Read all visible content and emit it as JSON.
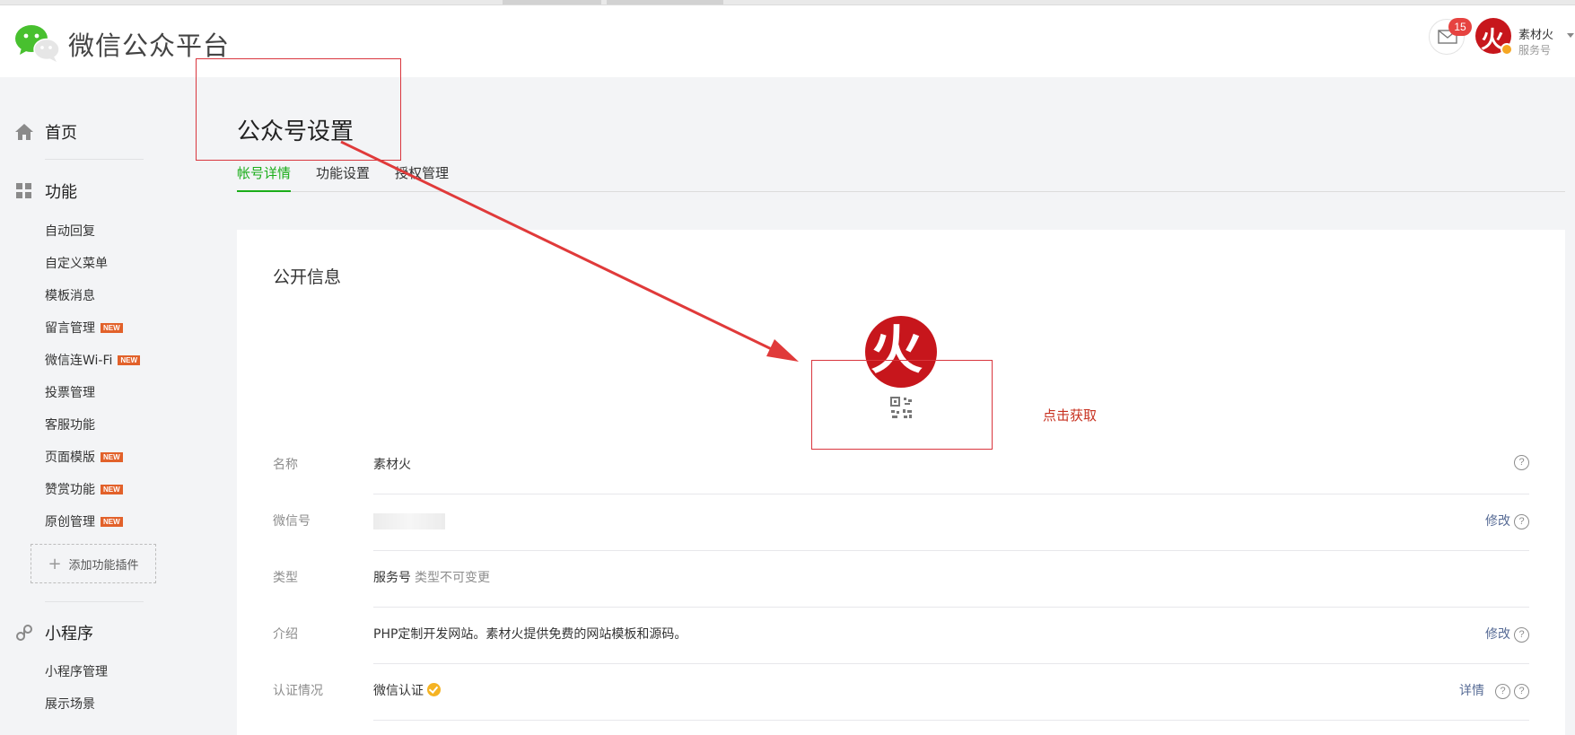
{
  "header": {
    "brand": "微信公众平台",
    "mail_badge": "15",
    "account_name": "素材火",
    "account_type": "服务号",
    "avatar_glyph": "火"
  },
  "sidebar": {
    "home": "首页",
    "features": "功能",
    "feature_items": [
      {
        "label": "自动回复",
        "new": false
      },
      {
        "label": "自定义菜单",
        "new": false
      },
      {
        "label": "模板消息",
        "new": false
      },
      {
        "label": "留言管理",
        "new": true
      },
      {
        "label": "微信连Wi-Fi",
        "new": true
      },
      {
        "label": "投票管理",
        "new": false
      },
      {
        "label": "客服功能",
        "new": false
      },
      {
        "label": "页面模版",
        "new": true
      },
      {
        "label": "赞赏功能",
        "new": true
      },
      {
        "label": "原创管理",
        "new": true
      }
    ],
    "new_tag": "NEW",
    "add_plugin": "添加功能插件",
    "miniprogram": "小程序",
    "miniprogram_items": [
      "小程序管理",
      "展示场景"
    ]
  },
  "main": {
    "title": "公众号设置",
    "tabs": [
      "帐号详情",
      "功能设置",
      "授权管理"
    ],
    "section_title": "公开信息",
    "avatar_glyph": "火",
    "get_qrcode": "点击获取",
    "rows": [
      {
        "label": "名称",
        "value": "素材火",
        "sub": "",
        "action": ""
      },
      {
        "label": "微信号",
        "value": "",
        "sub": "",
        "action": "修改"
      },
      {
        "label": "类型",
        "value": "服务号",
        "sub": "类型不可变更",
        "action": ""
      },
      {
        "label": "介绍",
        "value": "PHP定制开发网站。素材火提供免费的网站模板和源码。",
        "sub": "",
        "action": "修改"
      },
      {
        "label": "认证情况",
        "value": "微信认证",
        "sub": "",
        "action": "详情"
      }
    ],
    "help_glyph": "?"
  },
  "colors": {
    "accent_green": "#1aad19",
    "link_blue": "#576b95",
    "annotation_red": "#d9363e",
    "badge_red": "#e64340",
    "new_tag_orange": "#e2612a",
    "avatar_red": "#c7161c"
  }
}
